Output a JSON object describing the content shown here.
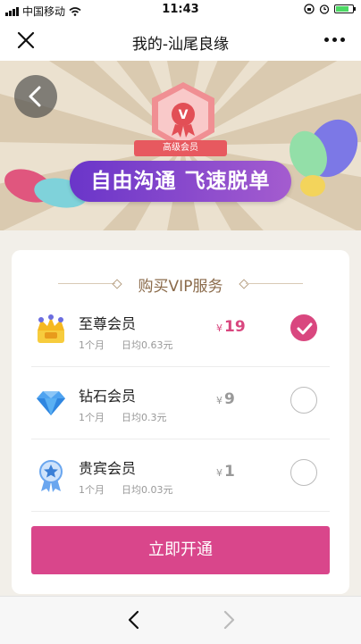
{
  "status_bar": {
    "carrier": "中国移动",
    "time": "11:43",
    "battery_percent": 0.75
  },
  "nav": {
    "title": "我的-汕尾良缘",
    "close_icon": "close-icon",
    "more_icon": "more-icon"
  },
  "banner": {
    "badge_letter": "V",
    "badge_label": "高级会员",
    "slogan": "自由沟通  飞速脱单",
    "back_icon": "chevron-left-icon"
  },
  "section": {
    "title": "购买VIP服务"
  },
  "vip_plans": [
    {
      "name": "至尊会员",
      "duration": "1个月",
      "daily": "日均0.63元",
      "currency": "¥",
      "price": "19",
      "selected": true,
      "icon": "crown-icon"
    },
    {
      "name": "钻石会员",
      "duration": "1个月",
      "daily": "日均0.3元",
      "currency": "¥",
      "price": "9",
      "selected": false,
      "icon": "diamond-icon"
    },
    {
      "name": "贵宾会员",
      "duration": "1个月",
      "daily": "日均0.03元",
      "currency": "¥",
      "price": "1",
      "selected": false,
      "icon": "medal-icon"
    }
  ],
  "actions": {
    "open_label": "立即开通"
  },
  "colors": {
    "accent": "#d9468b",
    "gold_text": "#8a6a4a"
  }
}
